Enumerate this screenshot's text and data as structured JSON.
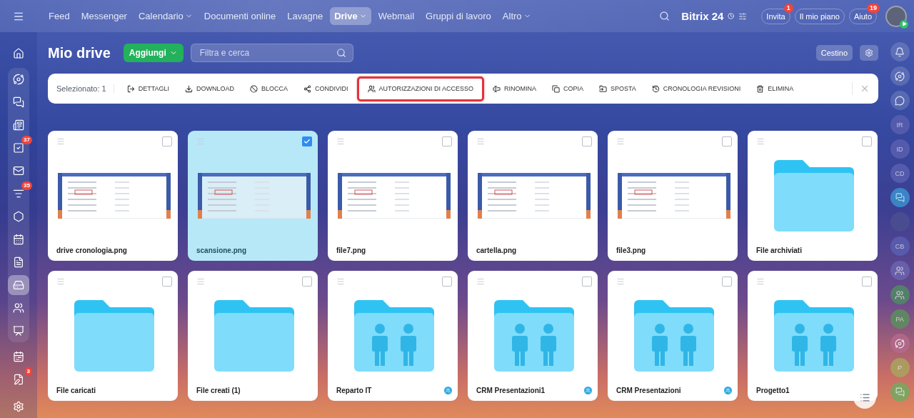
{
  "topbar": {
    "nav": [
      {
        "label": "Feed",
        "has_menu": false,
        "selected": false
      },
      {
        "label": "Messenger",
        "has_menu": false,
        "selected": false
      },
      {
        "label": "Calendario",
        "has_menu": true,
        "selected": false
      },
      {
        "label": "Documenti online",
        "has_menu": false,
        "selected": false
      },
      {
        "label": "Lavagne",
        "has_menu": false,
        "selected": false
      },
      {
        "label": "Drive",
        "has_menu": true,
        "selected": true
      },
      {
        "label": "Webmail",
        "has_menu": false,
        "selected": false
      },
      {
        "label": "Gruppi di lavoro",
        "has_menu": false,
        "selected": false
      },
      {
        "label": "Altro",
        "has_menu": true,
        "selected": false
      }
    ],
    "logo": {
      "name": "Bitrix",
      "number": "24"
    },
    "buttons": [
      {
        "label": "Invita",
        "badge": "1"
      },
      {
        "label": "Il mio piano"
      },
      {
        "label": "Aiuto",
        "badge": "19"
      }
    ]
  },
  "left_sidebar": {
    "items": [
      {
        "selected": false
      },
      {
        "selected": false
      },
      {
        "selected": false
      },
      {
        "selected": false
      },
      {
        "selected": false,
        "badge": "37"
      },
      {
        "selected": false
      },
      {
        "selected": false,
        "badge": "35"
      },
      {
        "selected": false
      },
      {
        "selected": false
      },
      {
        "selected": false
      },
      {
        "selected": true
      },
      {
        "selected": false
      },
      {
        "selected": false
      },
      {
        "selected": false
      },
      {
        "selected": false,
        "badge": "3"
      }
    ]
  },
  "right_sidebar": {
    "items": [
      {
        "kind": "icon"
      },
      {
        "kind": "icon"
      },
      {
        "kind": "icon"
      },
      {
        "kind": "initials",
        "initials": "IR",
        "color": "#5a5fb0"
      },
      {
        "kind": "initials",
        "initials": "ID",
        "color": "#5a5fb0"
      },
      {
        "kind": "initials",
        "initials": "CD",
        "color": "#5a5fb0"
      },
      {
        "kind": "chat",
        "color": "#3d8fd0"
      },
      {
        "kind": "photo",
        "color": "#4b4f8f"
      },
      {
        "kind": "initials",
        "initials": "CB",
        "color": "#5a5fb0"
      },
      {
        "kind": "group",
        "color": "#6a64b0"
      },
      {
        "kind": "group",
        "color": "#4f8a63"
      },
      {
        "kind": "initials",
        "initials": "PA",
        "color": "#5b8f5e"
      },
      {
        "kind": "icon",
        "color": "#b46a8c"
      },
      {
        "kind": "initials",
        "initials": "P",
        "color": "#a9a45e"
      },
      {
        "kind": "chat",
        "color": "#76a860"
      }
    ]
  },
  "header": {
    "title": "Mio drive",
    "add_button": "Aggiungi",
    "search": {
      "placeholder": "Filtra e cerca"
    },
    "trash_button": "Cestino"
  },
  "toolbar": {
    "selection": "Selezionato: 1",
    "actions": [
      {
        "label": "DETTAGLI",
        "highlighted": false
      },
      {
        "label": "DOWNLOAD",
        "highlighted": false
      },
      {
        "label": "BLOCCA",
        "highlighted": false
      },
      {
        "label": "CONDIVIDI",
        "highlighted": false
      },
      {
        "label": "AUTORIZZAZIONI DI ACCESSO",
        "highlighted": true
      },
      {
        "label": "RINOMINA",
        "highlighted": false
      },
      {
        "label": "COPIA",
        "highlighted": false
      },
      {
        "label": "SPOSTA",
        "highlighted": false
      },
      {
        "label": "CRONOLOGIA REVISIONI",
        "highlighted": false
      },
      {
        "label": "ELIMINA",
        "highlighted": false
      }
    ]
  },
  "cards": [
    {
      "kind": "image",
      "name": "drive cronologia.png",
      "checked": false,
      "shared": false
    },
    {
      "kind": "image",
      "name": "scansione.png",
      "checked": true,
      "shared": false
    },
    {
      "kind": "image",
      "name": "file7.png",
      "checked": false,
      "shared": false
    },
    {
      "kind": "image",
      "name": "cartella.png",
      "checked": false,
      "shared": false
    },
    {
      "kind": "image",
      "name": "file3.png",
      "checked": false,
      "shared": false
    },
    {
      "kind": "folder",
      "name": "File archiviati",
      "checked": false,
      "shared": false
    },
    {
      "kind": "folder",
      "name": "File caricati",
      "checked": false,
      "shared": false
    },
    {
      "kind": "folder",
      "name": "File creati (1)",
      "checked": false,
      "shared": false
    },
    {
      "kind": "group_folder",
      "name": "Reparto IT",
      "checked": false,
      "shared": true
    },
    {
      "kind": "group_folder",
      "name": "CRM Presentazioni1",
      "checked": false,
      "shared": true
    },
    {
      "kind": "group_folder",
      "name": "CRM Presentazioni",
      "checked": false,
      "shared": true
    },
    {
      "kind": "group_folder",
      "name": "Progetto1",
      "checked": false,
      "shared": false
    }
  ]
}
